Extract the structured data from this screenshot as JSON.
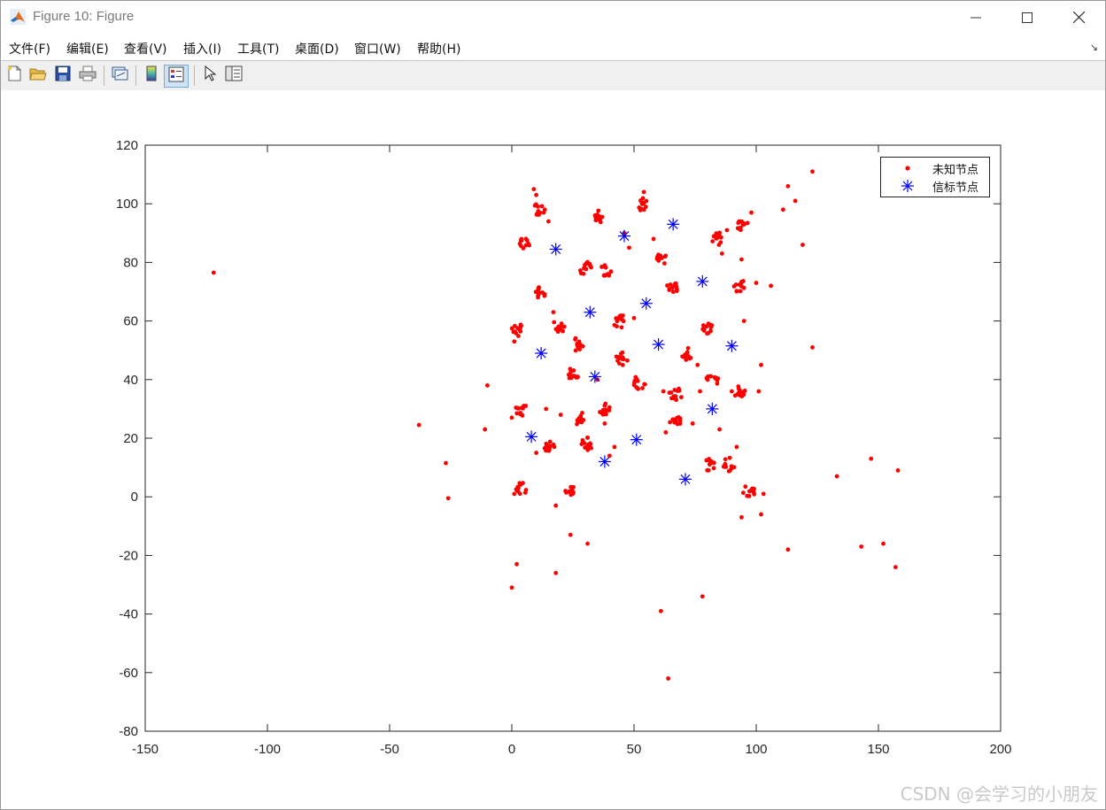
{
  "window": {
    "title": "Figure 10: Figure",
    "minimize_icon": "minimize-icon",
    "maximize_icon": "maximize-icon",
    "close_icon": "close-icon"
  },
  "menu": {
    "items": [
      "文件(F)",
      "编辑(E)",
      "查看(V)",
      "插入(I)",
      "工具(T)",
      "桌面(D)",
      "窗口(W)",
      "帮助(H)"
    ],
    "dock_arrow": "↘"
  },
  "toolbar": {
    "icons": [
      "new-figure-icon",
      "open-file-icon",
      "save-icon",
      "print-icon",
      "link-plot-icon",
      "insert-colorbar-icon",
      "insert-legend-icon",
      "edit-plot-icon",
      "property-editor-icon"
    ]
  },
  "chart_data": {
    "type": "scatter",
    "title": "",
    "xlabel": "",
    "ylabel": "",
    "xlim": [
      -150,
      200
    ],
    "ylim": [
      -80,
      120
    ],
    "xticks": [
      "-150",
      "-100",
      "-50",
      "0",
      "50",
      "100",
      "150",
      "200"
    ],
    "yticks": [
      "120",
      "100",
      "80",
      "60",
      "40",
      "20",
      "0",
      "-20",
      "-40",
      "-60",
      "-80"
    ],
    "grid": false,
    "legend_position": "top-right",
    "series": [
      {
        "name": "未知节点",
        "marker": "dot",
        "color": "#ff0000",
        "clusters": [
          [
            11,
            98
          ],
          [
            5,
            87
          ],
          [
            12,
            70
          ],
          [
            2,
            57
          ],
          [
            19,
            58
          ],
          [
            30,
            78
          ],
          [
            38,
            77
          ],
          [
            36,
            96
          ],
          [
            53,
            100
          ],
          [
            44,
            60
          ],
          [
            45,
            47
          ],
          [
            52,
            39
          ],
          [
            25,
            42
          ],
          [
            27,
            52
          ],
          [
            38,
            30
          ],
          [
            27,
            27
          ],
          [
            4,
            30
          ],
          [
            15,
            17
          ],
          [
            31,
            18
          ],
          [
            24,
            3
          ],
          [
            4,
            3
          ],
          [
            61,
            81
          ],
          [
            66,
            72
          ],
          [
            72,
            49
          ],
          [
            80,
            58
          ],
          [
            82,
            40
          ],
          [
            93,
            36
          ],
          [
            67,
            35
          ],
          [
            67,
            26
          ],
          [
            81,
            11
          ],
          [
            89,
            11
          ],
          [
            97,
            2
          ],
          [
            84,
            88
          ],
          [
            94,
            93
          ],
          [
            93,
            72
          ]
        ],
        "points": [
          [
            -122,
            76.5
          ],
          [
            -38,
            24.5
          ],
          [
            -27,
            11.5
          ],
          [
            -26,
            -0.5
          ],
          [
            -11,
            23
          ],
          [
            -10,
            38
          ],
          [
            0,
            27
          ],
          [
            1,
            1
          ],
          [
            1,
            53
          ],
          [
            0,
            -31
          ],
          [
            2,
            -23
          ],
          [
            9,
            105
          ],
          [
            10,
            103
          ],
          [
            15,
            94
          ],
          [
            17,
            63
          ],
          [
            18,
            -26
          ],
          [
            18,
            -3
          ],
          [
            10,
            15
          ],
          [
            14,
            30
          ],
          [
            20,
            28
          ],
          [
            24,
            -13
          ],
          [
            31,
            -16
          ],
          [
            35,
            40
          ],
          [
            38,
            25
          ],
          [
            40,
            14
          ],
          [
            42,
            17
          ],
          [
            46,
            90
          ],
          [
            48,
            85
          ],
          [
            50,
            61
          ],
          [
            54,
            104
          ],
          [
            58,
            88
          ],
          [
            62,
            36
          ],
          [
            63,
            22
          ],
          [
            61,
            -39
          ],
          [
            64,
            -62
          ],
          [
            74,
            25
          ],
          [
            76,
            45
          ],
          [
            77,
            36
          ],
          [
            78,
            -34
          ],
          [
            85,
            23
          ],
          [
            86,
            83
          ],
          [
            88,
            91
          ],
          [
            90,
            36
          ],
          [
            92,
            17
          ],
          [
            94,
            81
          ],
          [
            94,
            -7
          ],
          [
            95,
            60
          ],
          [
            98,
            97
          ],
          [
            100,
            73
          ],
          [
            101,
            36
          ],
          [
            102,
            45
          ],
          [
            102,
            -6
          ],
          [
            103,
            1
          ],
          [
            106,
            72
          ],
          [
            111,
            98
          ],
          [
            113,
            106
          ],
          [
            113,
            -18
          ],
          [
            116,
            101
          ],
          [
            119,
            86
          ],
          [
            123,
            111
          ],
          [
            123,
            51
          ],
          [
            133,
            7
          ],
          [
            143,
            -17
          ],
          [
            147,
            13
          ],
          [
            152,
            -16
          ],
          [
            157,
            -24
          ],
          [
            158,
            9
          ]
        ]
      },
      {
        "name": "信标节点",
        "marker": "asterisk",
        "color": "#0000ff",
        "points": [
          [
            18,
            84.5
          ],
          [
            46,
            89
          ],
          [
            66,
            93
          ],
          [
            78,
            73.5
          ],
          [
            32,
            63
          ],
          [
            55,
            66
          ],
          [
            60,
            52
          ],
          [
            90,
            51.5
          ],
          [
            12,
            49
          ],
          [
            34,
            41
          ],
          [
            82,
            30
          ],
          [
            8,
            20.5
          ],
          [
            51,
            19.5
          ],
          [
            38,
            12
          ],
          [
            71,
            6
          ]
        ]
      }
    ]
  },
  "watermark": "CSDN @会学习的小朋友"
}
